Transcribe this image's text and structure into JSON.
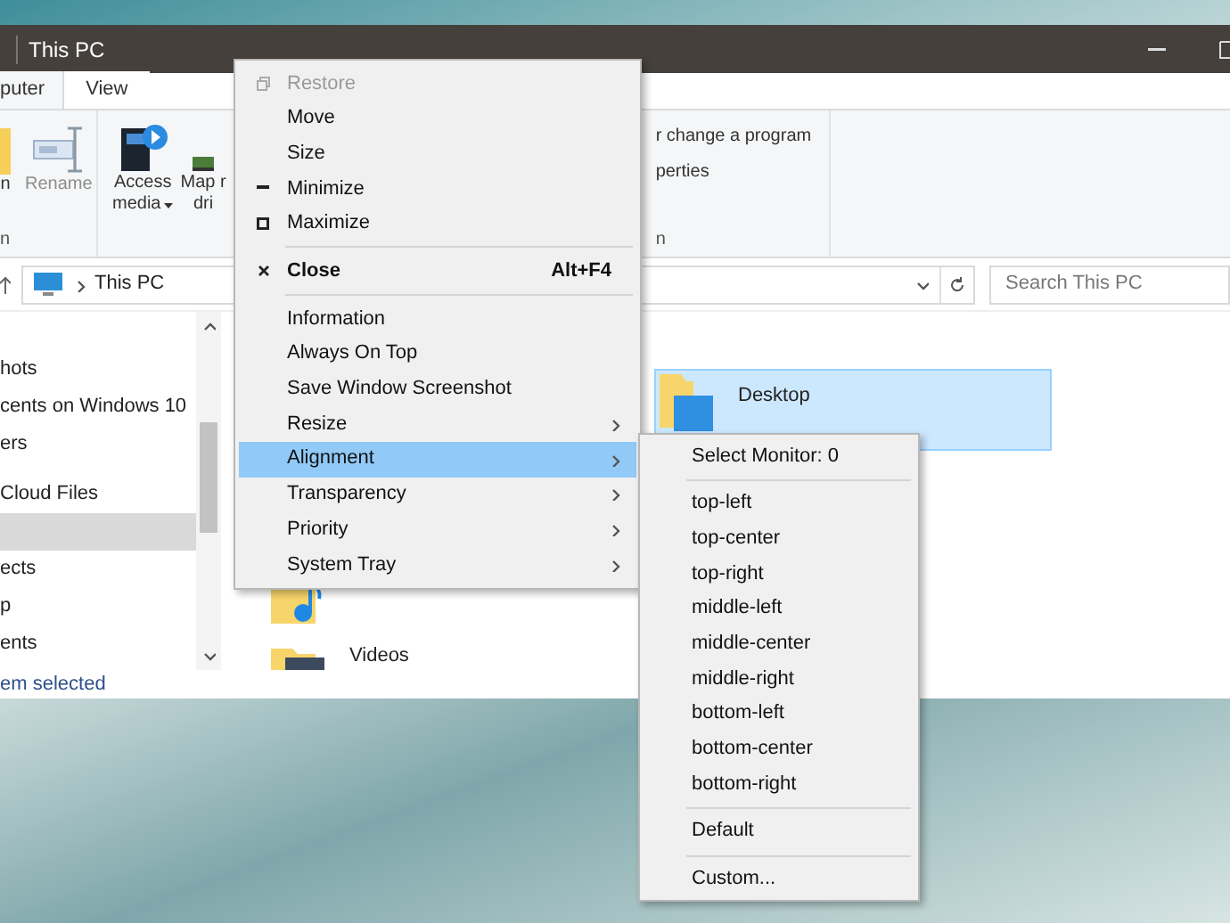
{
  "window": {
    "title": "This PC"
  },
  "ribbon_tabs": [
    {
      "label": "puter",
      "selected": true
    },
    {
      "label": "View",
      "selected": false
    }
  ],
  "ribbon_buttons": [
    {
      "kind": "open",
      "lines": [
        "n"
      ],
      "disabled": false
    },
    {
      "kind": "rename",
      "lines": [
        "Rename"
      ],
      "disabled": true
    },
    {
      "kind": "media",
      "lines": [
        "Access",
        "media"
      ],
      "disabled": false
    },
    {
      "kind": "drive",
      "lines": [
        "Map r",
        "dri"
      ],
      "disabled": false
    }
  ],
  "ribbon_group_labels": [
    "n",
    "n"
  ],
  "ribbon_links": [
    "r change a program",
    "perties"
  ],
  "address_bar": {
    "path": "This PC"
  },
  "search": {
    "placeholder": "Search This PC"
  },
  "nav_pane": {
    "items": [
      {
        "label": "hots",
        "selected": false
      },
      {
        "label": "cents on Windows 10",
        "selected": false
      },
      {
        "label": "ers",
        "selected": false
      },
      {
        "label": "Cloud Files",
        "selected": false
      },
      {
        "selected": true
      },
      {
        "label": "ects",
        "selected": false
      },
      {
        "label": "p",
        "selected": false
      },
      {
        "label": "ents",
        "selected": false
      }
    ]
  },
  "content_items": [
    {
      "kind": "desktop",
      "label": "Desktop",
      "selected": true
    },
    {
      "kind": "music",
      "selected": false
    },
    {
      "kind": "videos",
      "label": "Videos",
      "selected": false
    }
  ],
  "status_bar": "em selected",
  "context_menu": [
    {
      "kind": "restore",
      "label": "Restore",
      "disabled": true,
      "selected": false
    },
    {
      "kind": "item",
      "label": "Move",
      "disabled": false,
      "selected": false
    },
    {
      "kind": "item",
      "label": "Size",
      "disabled": false,
      "selected": false
    },
    {
      "kind": "minimize",
      "label": "Minimize",
      "disabled": false,
      "selected": false
    },
    {
      "kind": "maximize",
      "label": "Maximize",
      "disabled": false,
      "selected": false
    },
    {
      "kind": "separator"
    },
    {
      "kind": "close",
      "label": "Close",
      "shortcut": "Alt+F4",
      "disabled": false,
      "selected": false
    },
    {
      "kind": "separator"
    },
    {
      "kind": "item",
      "label": "Information",
      "disabled": false,
      "selected": false
    },
    {
      "kind": "item",
      "label": "Always On Top",
      "disabled": false,
      "selected": false
    },
    {
      "kind": "item",
      "label": "Save Window Screenshot",
      "disabled": false,
      "selected": false
    },
    {
      "kind": "submenu",
      "label": "Resize",
      "disabled": false,
      "selected": false
    },
    {
      "kind": "submenu",
      "label": "Alignment",
      "disabled": false,
      "selected": true
    },
    {
      "kind": "submenu",
      "label": "Transparency",
      "disabled": false,
      "selected": false
    },
    {
      "kind": "submenu",
      "label": "Priority",
      "disabled": false,
      "selected": false
    },
    {
      "kind": "submenu",
      "label": "System Tray",
      "disabled": false,
      "selected": false
    }
  ],
  "alignment_submenu": [
    {
      "kind": "item",
      "label": "Select Monitor: 0"
    },
    {
      "kind": "separator"
    },
    {
      "kind": "item",
      "label": "top-left"
    },
    {
      "kind": "item",
      "label": "top-center"
    },
    {
      "kind": "item",
      "label": "top-right"
    },
    {
      "kind": "item",
      "label": "middle-left"
    },
    {
      "kind": "item",
      "label": "middle-center"
    },
    {
      "kind": "item",
      "label": "middle-right"
    },
    {
      "kind": "item",
      "label": "bottom-left"
    },
    {
      "kind": "item",
      "label": "bottom-center"
    },
    {
      "kind": "item",
      "label": "bottom-right"
    },
    {
      "kind": "separator"
    },
    {
      "kind": "item",
      "label": "Default"
    },
    {
      "kind": "separator"
    },
    {
      "kind": "item",
      "label": "Custom..."
    }
  ]
}
